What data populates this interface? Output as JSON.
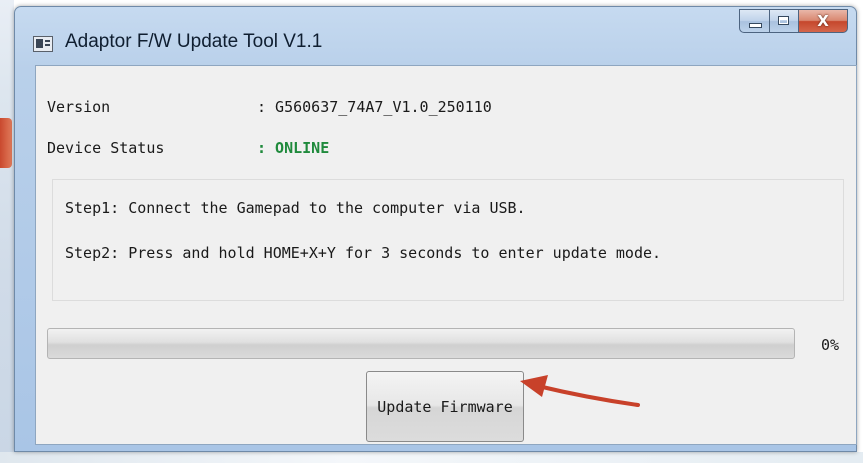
{
  "window": {
    "title": "Adaptor F/W Update Tool V1.1",
    "caption_buttons": {
      "minimize_icon": "minimize-icon",
      "maximize_icon": "maximize-icon",
      "close_icon": "close-icon",
      "close_glyph": "X"
    }
  },
  "info": {
    "version_label": "Version",
    "version_value": ": G560637_74A7_V1.0_250110",
    "status_label": "Device Status",
    "status_value": ": ONLINE",
    "status_color": "#1f8a3c"
  },
  "steps": [
    "Step1: Connect the Gamepad to the computer via USB.",
    "Step2: Press and hold HOME+X+Y for 3 seconds to enter update mode."
  ],
  "progress": {
    "value": 0,
    "text": "0%"
  },
  "actions": {
    "update_label": "Update Firmware"
  },
  "annotation": {
    "arrow_icon": "red-arrow-icon",
    "arrow_color": "#c8412a"
  }
}
